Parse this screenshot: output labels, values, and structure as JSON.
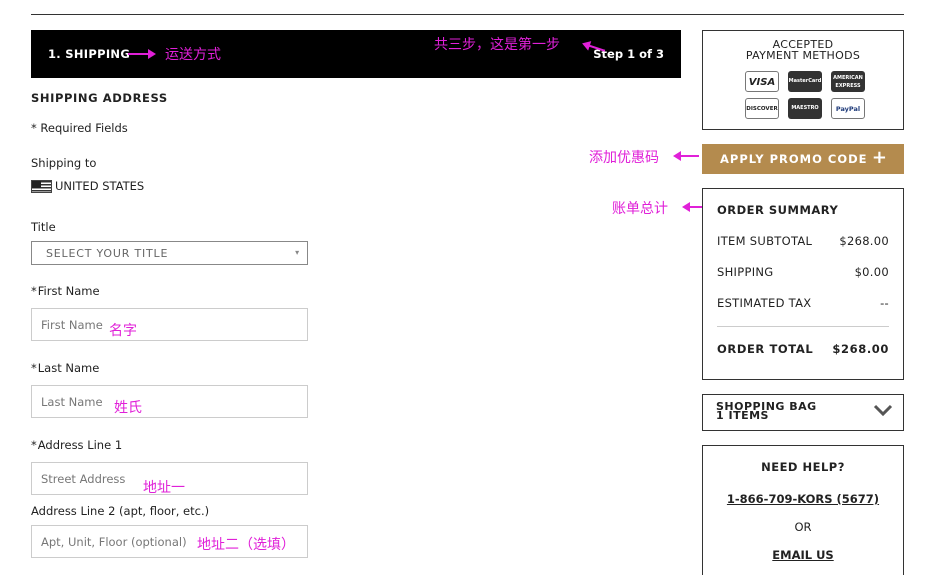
{
  "step": {
    "title": "1. SHIPPING",
    "count": "Step 1 of 3"
  },
  "annotations": {
    "shipping_method": "运送方式",
    "steps": "共三步，这是第一步",
    "promo": "添加优惠码",
    "summary": "账单总计",
    "first_name": "名字",
    "last_name": "姓氏",
    "address1": "地址一",
    "address2": "地址二（选填）"
  },
  "shipping": {
    "heading": "SHIPPING ADDRESS",
    "required": "*  Required Fields",
    "shipping_to_label": "Shipping to",
    "country": "UNITED STATES",
    "title_label": "Title",
    "title_select": "SELECT YOUR TITLE",
    "first_name_label": "First Name",
    "first_name_placeholder": "First Name",
    "last_name_label": "Last Name",
    "last_name_placeholder": "Last Name",
    "address1_label": "Address Line 1",
    "address1_placeholder": "Street Address",
    "address2_label": "Address Line 2 (apt, floor, etc.)",
    "address2_placeholder": "Apt, Unit, Floor (optional)"
  },
  "payment": {
    "title_line1": "ACCEPTED",
    "title_line2": "PAYMENT METHODS",
    "cards": [
      "VISA",
      "MasterCard",
      "AMERICAN EXPRESS",
      "DISCOVER",
      "MAESTRO",
      "PayPal"
    ]
  },
  "promo": {
    "label": "APPLY PROMO CODE",
    "icon": "+"
  },
  "summary": {
    "heading": "ORDER SUMMARY",
    "subtotal_label": "ITEM SUBTOTAL",
    "subtotal_value": "$268.00",
    "shipping_label": "SHIPPING",
    "shipping_value": "$0.00",
    "tax_label": "ESTIMATED TAX",
    "tax_value": "--",
    "total_label": "ORDER TOTAL",
    "total_value": "$268.00"
  },
  "bag": {
    "line1": "SHOPPING BAG",
    "line2": "1 ITEMS"
  },
  "help": {
    "title": "NEED HELP?",
    "phone": "1-866-709-KORS (5677)",
    "or": "OR",
    "email": "EMAIL US"
  },
  "colors": {
    "accent": "#b48b4e",
    "annotation": "#e020d8",
    "banner": "#000000"
  }
}
